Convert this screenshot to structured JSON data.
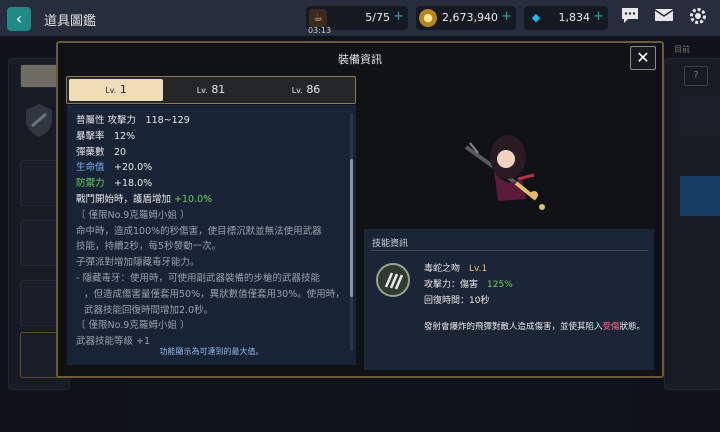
{
  "header": {
    "back_label": "‹",
    "title": "道具圖鑑",
    "resources": [
      {
        "icon": "coffee-cup-icon",
        "value": "5/75",
        "sub": "03:13"
      },
      {
        "icon": "gold-coin-icon",
        "value": "2,673,940"
      },
      {
        "icon": "blue-gem-icon",
        "value": "1,834"
      }
    ],
    "right_icons": [
      "chat-icon",
      "mail-icon",
      "settings-gear-icon"
    ]
  },
  "background": {
    "right_label": "目前"
  },
  "modal": {
    "title": "裝備資訊",
    "close_label": "✕",
    "tabs": [
      {
        "prefix": "Lv.",
        "value": "1",
        "active": true
      },
      {
        "prefix": "Lv.",
        "value": "81",
        "active": false
      },
      {
        "prefix": "Lv.",
        "value": "86",
        "active": false
      }
    ],
    "stats": [
      {
        "key": "普屬性",
        "value": "攻擊力　118~129"
      },
      {
        "key": "暴擊率",
        "value": "12%"
      },
      {
        "key": "彈藥數",
        "value": "20"
      },
      {
        "key": "生命值",
        "value": "+20.0%"
      },
      {
        "key": "防禦力",
        "value": "+18.0%"
      }
    ],
    "battle_start": {
      "label": "戰鬥開始時，護盾增加",
      "value": "+10.0%"
    },
    "desc_lines": [
      "〔 僅限No.9克羅姆小姐 〕",
      "命中時，造成100%的秒傷害，使目標沉默並無法使用武器",
      "技能，持續2秒，每5秒發動一次。",
      "子彈派對增加隱藏毒牙能力。",
      "- 隱藏毒牙：使用時，可使用副武器裝備的步槍的武器技能",
      "，但造成傷害量僅套用50%，異狀數值僅套用30%。使用時，",
      "武器技能回復時間增加2.0秒。",
      "〔 僅限No.9克羅姆小姐 〕",
      "武器技能等級 +1"
    ],
    "footnote": "功能顯示為可達到的最大值。"
  },
  "skill": {
    "header": "技能資訊",
    "name": "毒蛇之吻",
    "level": "Lv.1",
    "attack_label": "攻擊力：傷害",
    "attack_value": "125%",
    "cooldown": "回復時間：10秒",
    "desc_pre": "發射會爆炸的飛彈對敵人造成傷害，並使其陷入",
    "desc_status": "受傷",
    "desc_post": "狀態。"
  },
  "colors": {
    "accent_teal": "#1f8a86",
    "tab_active": "#f0dcb7",
    "modal_border": "#6b5a37",
    "stat_blue": "#6fb0ee",
    "stat_green": "#6ccf63",
    "status_pink": "#ff6a8a"
  }
}
